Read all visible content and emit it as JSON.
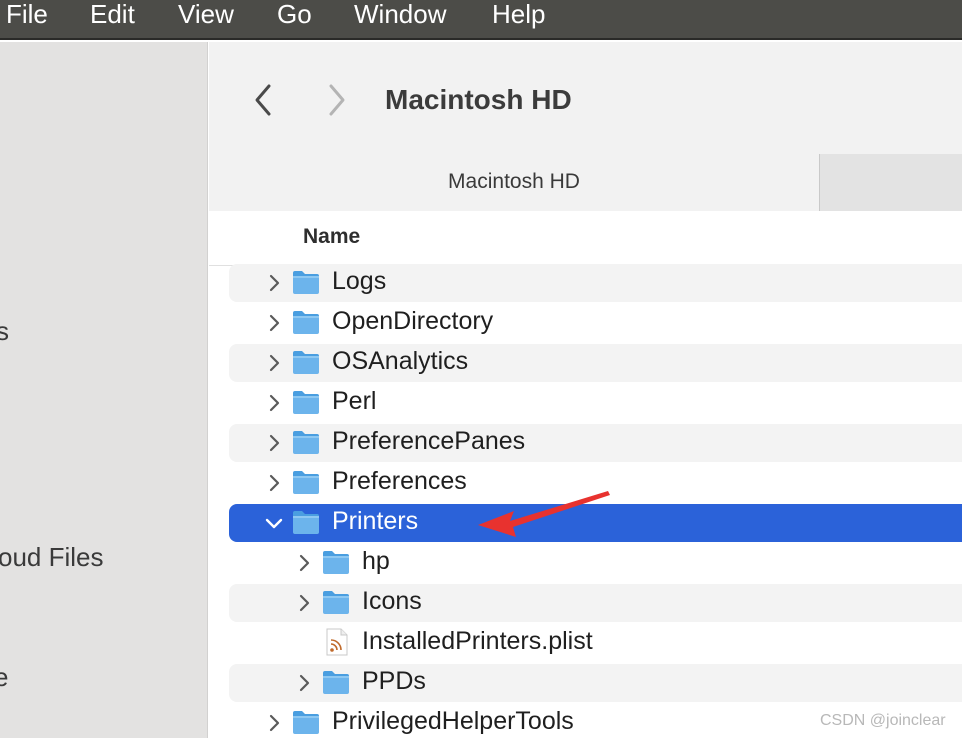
{
  "menubar": {
    "items": [
      "File",
      "Edit",
      "View",
      "Go",
      "Window",
      "Help"
    ]
  },
  "sidebar": {
    "fragments": [
      "s",
      "oud Files",
      "e"
    ]
  },
  "toolbar": {
    "back_icon": "chevron-left-icon",
    "forward_icon": "chevron-right-icon",
    "title": "Macintosh HD"
  },
  "tabs": {
    "active_label": "Macintosh HD"
  },
  "column_header": {
    "name_label": "Name"
  },
  "files": [
    {
      "name": "Logs",
      "type": "folder",
      "level": 0,
      "expanded": false
    },
    {
      "name": "OpenDirectory",
      "type": "folder",
      "level": 0,
      "expanded": false
    },
    {
      "name": "OSAnalytics",
      "type": "folder",
      "level": 0,
      "expanded": false
    },
    {
      "name": "Perl",
      "type": "folder",
      "level": 0,
      "expanded": false
    },
    {
      "name": "PreferencePanes",
      "type": "folder",
      "level": 0,
      "expanded": false
    },
    {
      "name": "Preferences",
      "type": "folder",
      "level": 0,
      "expanded": false
    },
    {
      "name": "Printers",
      "type": "folder",
      "level": 0,
      "expanded": true,
      "selected": true
    },
    {
      "name": "hp",
      "type": "folder",
      "level": 1,
      "expanded": false
    },
    {
      "name": "Icons",
      "type": "folder",
      "level": 1,
      "expanded": false
    },
    {
      "name": "InstalledPrinters.plist",
      "type": "plist",
      "level": 1
    },
    {
      "name": "PPDs",
      "type": "folder",
      "level": 1,
      "expanded": false
    },
    {
      "name": "PrivilegedHelperTools",
      "type": "folder",
      "level": 0,
      "expanded": false
    }
  ],
  "watermark": "CSDN @joinclear",
  "colors": {
    "selection": "#2b62d9",
    "folder": "#6cb4ec",
    "annotation_arrow": "#e8322f"
  }
}
